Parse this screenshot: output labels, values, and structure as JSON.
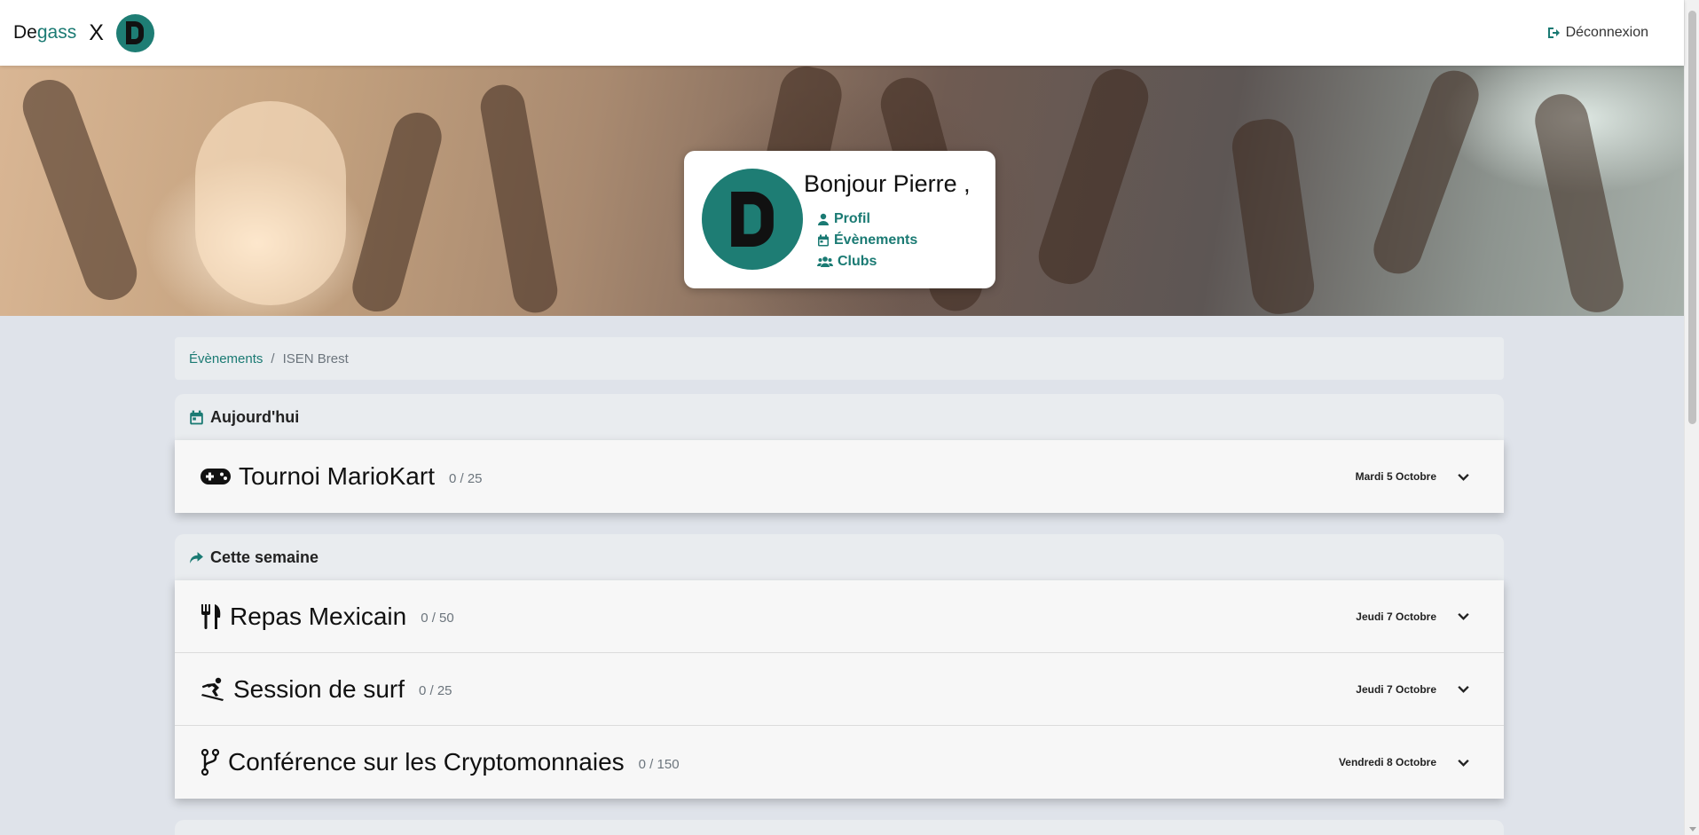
{
  "nav": {
    "brand_part1": "De",
    "brand_part2": "gass",
    "brand_x": "X",
    "logout_label": "Déconnexion"
  },
  "hero": {
    "greeting": "Bonjour Pierre ,",
    "links": [
      {
        "label": "Profil",
        "icon": "user-icon"
      },
      {
        "label": "Évènements",
        "icon": "calendar-icon"
      },
      {
        "label": "Clubs",
        "icon": "users-icon"
      }
    ]
  },
  "breadcrumb": {
    "link": "Évènements",
    "separator": "/",
    "current": "ISEN Brest"
  },
  "sections": [
    {
      "title": "Aujourd'hui",
      "icon": "calendar-icon",
      "events": [
        {
          "title": "Tournoi MarioKart",
          "count": "0 / 25",
          "date": "Mardi 5 Octobre",
          "icon": "gamepad-icon"
        }
      ]
    },
    {
      "title": "Cette semaine",
      "icon": "share-icon",
      "events": [
        {
          "title": "Repas Mexicain",
          "count": "0 / 50",
          "date": "Jeudi 7 Octobre",
          "icon": "utensils-icon"
        },
        {
          "title": "Session de surf",
          "count": "0 / 25",
          "date": "Jeudi 7 Octobre",
          "icon": "snowboarding-icon"
        },
        {
          "title": "Conférence sur les Cryptomonnaies",
          "count": "0 / 150",
          "date": "Vendredi 8 Octobre",
          "icon": "code-branch-icon"
        }
      ]
    }
  ],
  "colors": {
    "accent": "#1a7a73",
    "logo_bg": "#1e7d74",
    "page_bg": "#dfe3ea"
  }
}
